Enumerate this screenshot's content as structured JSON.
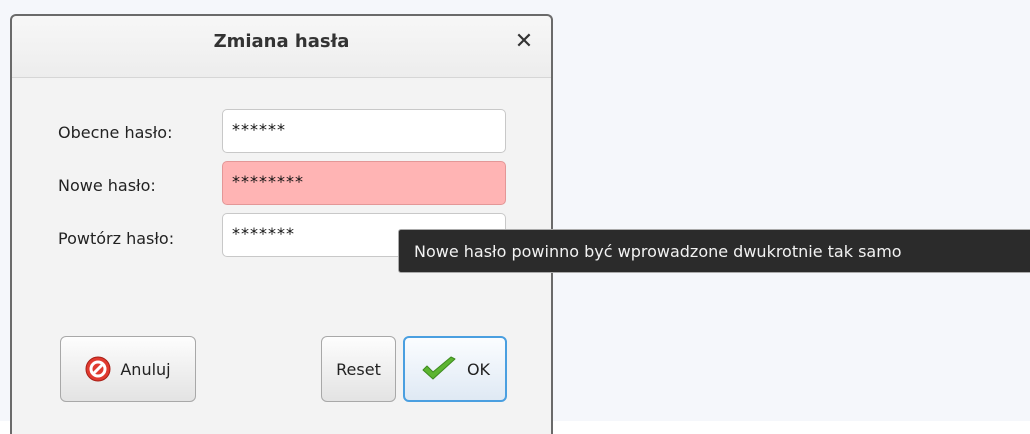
{
  "dialog": {
    "title": "Zmiana hasła",
    "close_glyph": "✕",
    "fields": [
      {
        "label": "Obecne hasło:",
        "value": "******",
        "state": "normal"
      },
      {
        "label": "Nowe hasło:",
        "value": "********",
        "state": "error"
      },
      {
        "label": "Powtórz hasło:",
        "value": "*******",
        "state": "normal"
      }
    ],
    "tooltip": "Nowe hasło powinno być wprowadzone dwukrotnie tak samo",
    "buttons": {
      "cancel": {
        "label": "Anuluj",
        "icon": "cancel-icon"
      },
      "reset": {
        "label": "Reset"
      },
      "ok": {
        "label": "OK",
        "icon": "checkmark-icon"
      }
    }
  },
  "colors": {
    "error_field": "#ffb4b4",
    "tooltip_bg": "#2b2b2b",
    "ok_border": "#4a9fe0",
    "cancel_icon": "#e03a2f",
    "check_icon": "#5cb531"
  }
}
